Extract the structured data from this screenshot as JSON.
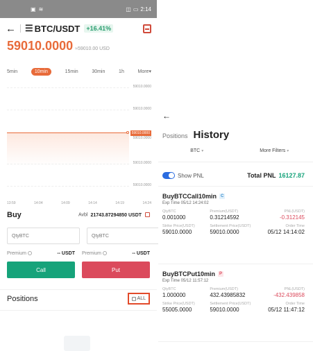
{
  "left": {
    "status_time": "2:14",
    "pair": "BTC/USDT",
    "change": "+16.41%",
    "price": "59010.0000",
    "price_sub": "≈59010.00 USD",
    "intervals": [
      "5min",
      "10min",
      "15min",
      "30min",
      "1h",
      "More"
    ],
    "active_interval": "10min",
    "y_labels": [
      "59010.0000",
      "59010.0000",
      "59010.0000",
      "59010.0000",
      "59010.0000",
      "59010.0000"
    ],
    "marker_label": "59010.0000",
    "x_labels": [
      "13:59",
      "14:04",
      "14:09",
      "14:14",
      "14:19",
      "14:24"
    ],
    "buy_title": "Buy",
    "avbl_label": "Avbl",
    "avbl_value": "21743.87294850 USDT",
    "qty_placeholder": "QtyBTC",
    "premium_label": "Premium",
    "premium_value": "-- USDT",
    "call_label": "Call",
    "put_label": "Put",
    "positions_title": "Positions",
    "all_label": "ALL"
  },
  "right": {
    "tab_positions": "Positions",
    "tab_history": "History",
    "filter_coin": "BTC",
    "filter_more": "More Filters",
    "show_pnl": "Show PNL",
    "total_pnl_label": "Total PNL",
    "total_pnl_value": "16127.87",
    "labels": {
      "qty": "QtyBTC",
      "premium": "Premium(USDT)",
      "pnl": "PNL(USDT)",
      "strike": "Strike Price(USDT)",
      "settlement": "Settlement Price(USDT)",
      "order_time": "Order Time"
    },
    "cards": [
      {
        "title": "BuyBTCCall10min",
        "tag": "C",
        "exp": "Exp Time 05/12 14:24:02",
        "qty": "0.001000",
        "premium": "0.31214592",
        "pnl": "-0.312145",
        "strike": "59010.0000",
        "settlement": "59010.0000",
        "order_time": "05/12 14:14:02"
      },
      {
        "title": "BuyBTCPut10min",
        "tag": "P",
        "exp": "Exp Time 05/12 11:57:12",
        "qty": "1.000000",
        "premium": "432.43985832",
        "pnl": "-432.439858",
        "strike": "55005.0000",
        "settlement": "59010.0000",
        "order_time": "05/12 11:47:12"
      }
    ]
  },
  "colors": {
    "accent": "#e86b3a",
    "call": "#16a37a",
    "put": "#db4a5c",
    "toggle": "#2b6ce0",
    "highlight": "#e24a2a"
  }
}
